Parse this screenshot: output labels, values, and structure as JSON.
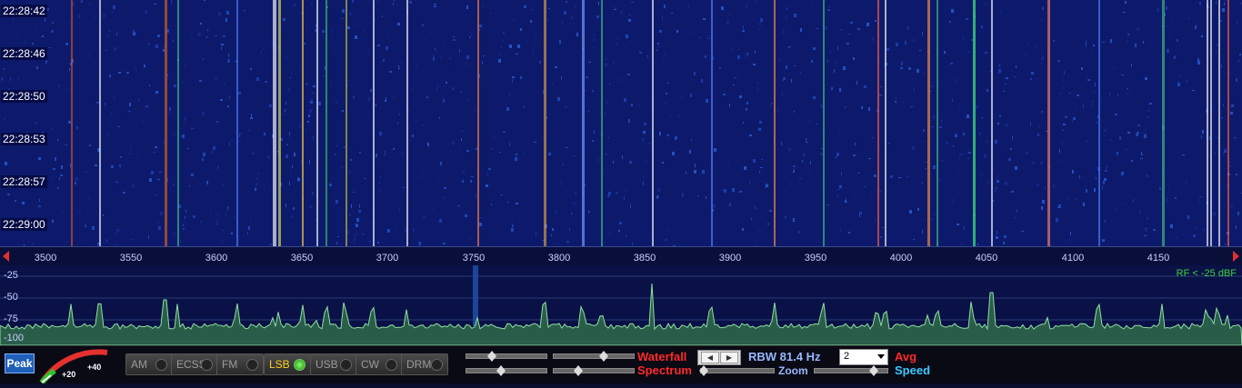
{
  "waterfall": {
    "time_labels": [
      "22:28:42",
      "22:28:46",
      "22:28:50",
      "22:28:53",
      "22:28:57",
      "22:29:00"
    ]
  },
  "frequency_axis": {
    "ticks": [
      "3500",
      "3550",
      "3600",
      "3650",
      "3700",
      "3750",
      "3800",
      "3850",
      "3900",
      "3950",
      "4000",
      "4050",
      "4100",
      "4150"
    ]
  },
  "spectrum": {
    "db_labels": [
      "-25",
      "-50",
      "-75",
      "-100"
    ],
    "rf_label": "RF < -25 dBF"
  },
  "controls": {
    "peak_label": "Peak",
    "smeter_labels": [
      "+20",
      "+40"
    ],
    "modes": [
      {
        "label": "AM",
        "active": false
      },
      {
        "label": "ECSS",
        "active": false
      },
      {
        "label": "FM",
        "active": false
      },
      {
        "label": "LSB",
        "active": true
      },
      {
        "label": "USB",
        "active": false
      },
      {
        "label": "CW",
        "active": false
      },
      {
        "label": "DRM",
        "active": false
      }
    ],
    "waterfall_label": "Waterfall",
    "spectrum_label": "Spectrum",
    "zoom_label": "Zoom",
    "rbw_label": "RBW 81.4 Hz",
    "avg_value": "2",
    "avg_label": "Avg",
    "speed_label": "Speed"
  },
  "colors": {
    "waterfall_bg": "#0d1a6b",
    "spectrum_bg": "#0a1146",
    "active_mode": "#ffd020",
    "accent_red": "#ff2a2a",
    "accent_cyan": "#40c8ff"
  }
}
